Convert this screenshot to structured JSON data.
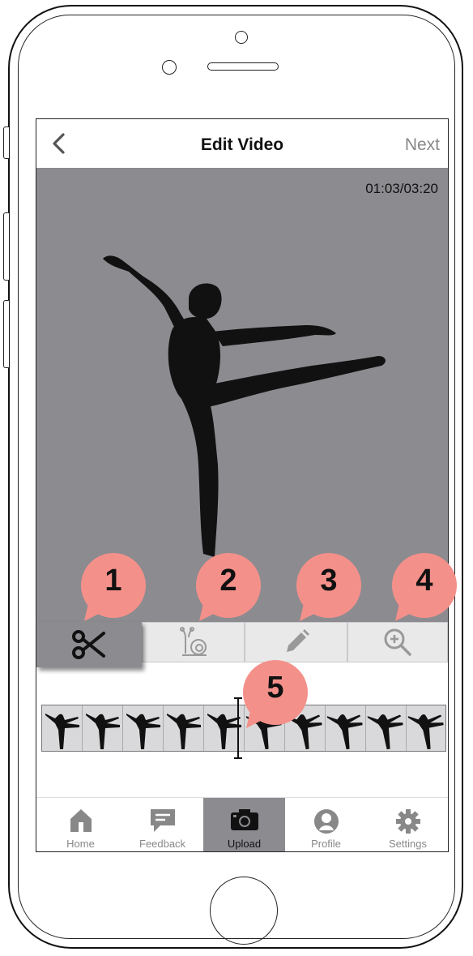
{
  "header": {
    "back_icon": "chevron-left-icon",
    "title": "Edit Video",
    "next_label": "Next"
  },
  "video": {
    "timestamp": "01:03/03:20",
    "subject": "dancer-silhouette"
  },
  "tools": [
    {
      "icon": "scissors-icon",
      "active": true
    },
    {
      "icon": "snail-icon",
      "active": false
    },
    {
      "icon": "pencil-icon",
      "active": false
    },
    {
      "icon": "zoom-in-icon",
      "active": false
    }
  ],
  "callouts": [
    "1",
    "2",
    "3",
    "4",
    "5"
  ],
  "tabs": [
    {
      "label": "Home",
      "icon": "home-icon"
    },
    {
      "label": "Feedback",
      "icon": "feedback-icon"
    },
    {
      "label": "Upload",
      "icon": "camera-icon",
      "active": true
    },
    {
      "label": "Profile",
      "icon": "profile-icon"
    },
    {
      "label": "Settings",
      "icon": "gear-icon"
    }
  ],
  "colors": {
    "accent_gray": "#8c8b90",
    "callout_pink": "#f4908a",
    "tool_bg": "#e9e9ea"
  }
}
